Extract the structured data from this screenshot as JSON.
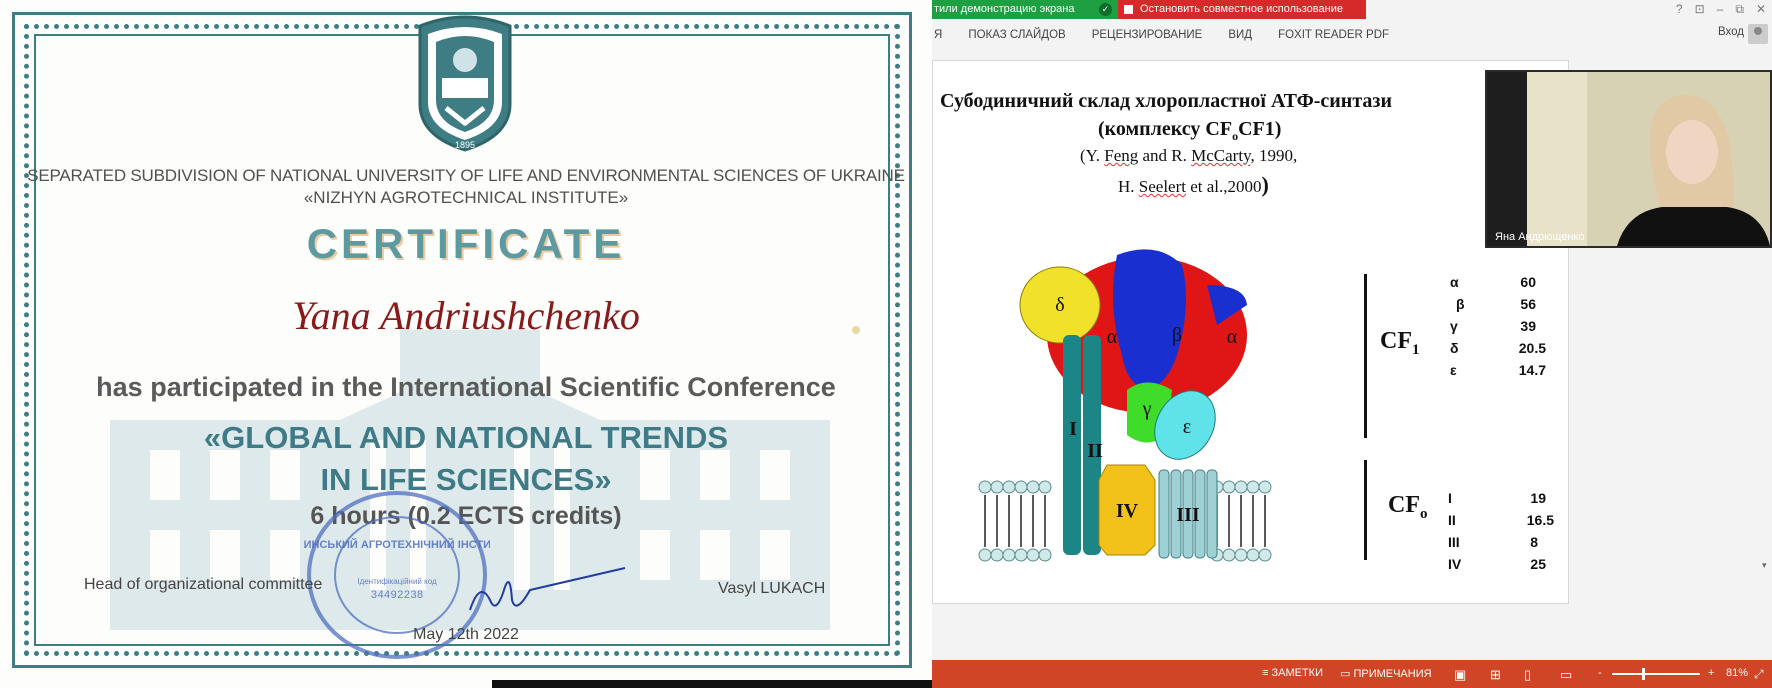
{
  "certificate": {
    "org_line1": "SEPARATED SUBDIVISION OF NATIONAL UNIVERSITY OF LIFE AND ENVIRONMENTAL SCIENCES OF UKRAINE",
    "org_line2": "«NIZHYN AGROTECHNICAL INSTITUTE»",
    "title": "CERTIFICATE",
    "name": "Yana Andriushchenko",
    "participation": "has participated in the International Scientific Conference",
    "conference_line1": "«GLOBAL AND NATIONAL TRENDS",
    "conference_line2": "IN LIFE SCIENCES»",
    "hours": "6 hours (0.2 ECTS credits)",
    "head_label": "Head of organizational committee",
    "signer": "Vasyl LUKACH",
    "date": "May 12th 2022",
    "emblem_year": "1895",
    "stamp_text": "НІЖИНСЬКИЙ АГРОТЕХНІЧНИЙ ІНСТИТУТ",
    "stamp_code": "34492238",
    "stamp_small": "Ідентифікаційний код"
  },
  "powerpoint": {
    "share_banner": "тили демонстрацию экрана",
    "stop_sharing": "Остановить совместное использование",
    "ribbon_tabs": [
      "Я",
      "ПОКАЗ СЛАЙДОВ",
      "РЕЦЕНЗИРОВАНИЕ",
      "ВИД",
      "FOXIT READER PDF"
    ],
    "login": "Вход",
    "window_controls": [
      "?",
      "⊡",
      "–",
      "⧉",
      "✕"
    ],
    "slide": {
      "title_line1": "Субодиничний склад хлоропластної АТФ-синтази",
      "title_line2_prefix": "(комплексу CF",
      "title_line2_sub": "o",
      "title_line2_suffix": "CF1)",
      "ref_line1_a": "(Y. ",
      "ref_line1_b": "Feng",
      "ref_line1_c": " and R. ",
      "ref_line1_d": "McCarty",
      "ref_line1_e": ", 1990,",
      "ref_line2_a": "H. ",
      "ref_line2_b": "Seelert",
      "ref_line2_c": " et al.,2000",
      "ref_line2_d": ")",
      "cf1_label": "CF",
      "cf1_sub": "1",
      "cfo_label": "CF",
      "cfo_sub": "o",
      "diagram_labels": {
        "delta": "δ",
        "alpha_left": "α",
        "beta": "β",
        "alpha_right": "α",
        "gamma": "γ",
        "epsilon": "ε",
        "I": "I",
        "II": "II",
        "III": "III",
        "IV": "IV"
      },
      "cf1_table": [
        {
          "k": "α",
          "v": "60"
        },
        {
          "k": "β",
          "v": "56"
        },
        {
          "k": "γ",
          "v": "39"
        },
        {
          "k": "δ",
          "v": "20.5"
        },
        {
          "k": "ε",
          "v": "14.7"
        }
      ],
      "cfo_table": [
        {
          "k": "I",
          "v": "19"
        },
        {
          "k": "II",
          "v": "16.5"
        },
        {
          "k": "III",
          "v": "8"
        },
        {
          "k": "IV",
          "v": "25"
        }
      ]
    },
    "webcam_name": "Яна Андрющенко",
    "status": {
      "notes": "ЗАМЕТКИ",
      "comments": "ПРИМЕЧАНИЯ",
      "zoom": "81%",
      "minus": "-",
      "plus": "+"
    },
    "colors": {
      "green": "#1e9f42",
      "red": "#d52a2a",
      "status": "#d04525",
      "teal": "#3d7d83"
    }
  }
}
